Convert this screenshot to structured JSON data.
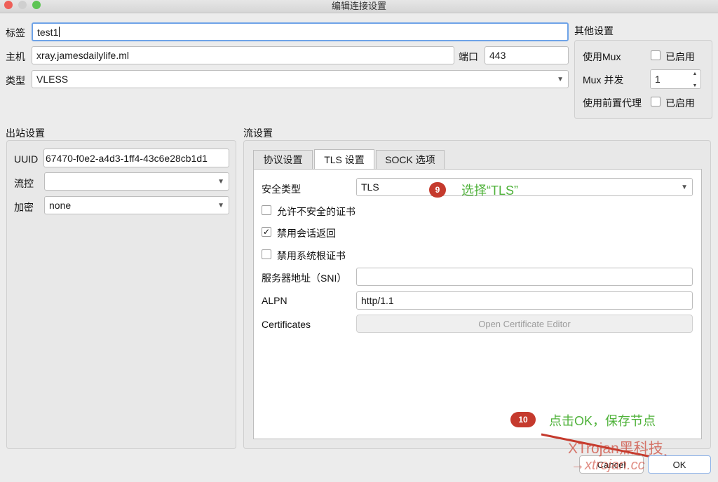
{
  "window": {
    "title": "编辑连接设置"
  },
  "main": {
    "tag_label": "标签",
    "tag_value": "test1",
    "host_label": "主机",
    "host_value": "xray.jamesdailylife.ml",
    "port_label": "端口",
    "port_value": "443",
    "type_label": "类型",
    "type_value": "VLESS"
  },
  "other": {
    "title": "其他设置",
    "mux_label": "使用Mux",
    "mux_enabled_label": "已启用",
    "mux_concurrency_label": "Mux 并发",
    "mux_concurrency_value": "1",
    "front_proxy_label": "使用前置代理",
    "front_proxy_enabled_label": "已启用"
  },
  "outbound": {
    "title": "出站设置",
    "uuid_label": "UUID",
    "uuid_value": "67470-f0e2-a4d3-1ff4-43c6e28cb1d1",
    "flow_label": "流控",
    "flow_value": "",
    "encryption_label": "加密",
    "encryption_value": "none"
  },
  "stream": {
    "title": "流设置",
    "tabs": [
      {
        "label": "协议设置"
      },
      {
        "label": "TLS 设置"
      },
      {
        "label": "SOCK 选项"
      }
    ],
    "security_type_label": "安全类型",
    "security_type_value": "TLS",
    "allow_insecure_label": "允许不安全的证书",
    "allow_insecure_checked": false,
    "disable_session_resume_label": "禁用会话返回",
    "disable_session_resume_checked": true,
    "disable_system_root_label": "禁用系统根证书",
    "disable_system_root_checked": false,
    "sni_label": "服务器地址（SNI）",
    "sni_value": "",
    "alpn_label": "ALPN",
    "alpn_value": "http/1.1",
    "certificates_label": "Certificates",
    "cert_editor_button": "Open Certificate Editor"
  },
  "annotations": {
    "step9_number": "9",
    "step9_text": "选择“TLS”",
    "step10_number": "10",
    "step10_text": "点击OK，保存节点",
    "watermark_line1": "XTrojan黑科技",
    "watermark_line2": "→xtrojan.cc"
  },
  "buttons": {
    "cancel": "Cancel",
    "ok": "OK"
  },
  "colors": {
    "badge": "#c53a2d",
    "annotation_text": "#4fb23a",
    "focus_border": "#6ea3e8",
    "arrow": "#c53a2d"
  }
}
